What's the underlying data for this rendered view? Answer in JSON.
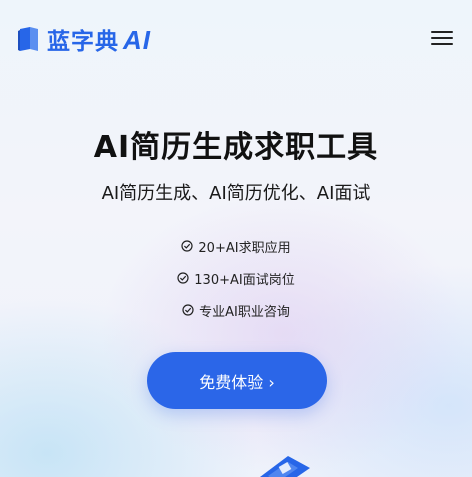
{
  "header": {
    "logo_text": "蓝字典",
    "logo_ai": "AI",
    "menu_icon": "hamburger-menu-icon"
  },
  "hero": {
    "title": "AI简历生成求职工具",
    "subtitle": "AI简历生成、AI简历优化、AI面试",
    "features": [
      {
        "icon": "check-circle-icon",
        "label": "20+AI求职应用"
      },
      {
        "icon": "check-circle-icon",
        "label": "130+AI面试岗位"
      },
      {
        "icon": "check-circle-icon",
        "label": "专业AI职业咨询"
      }
    ],
    "cta_label": "免费体验 ›"
  },
  "colors": {
    "brand": "#2766e8",
    "cta_bg": "#2b66e8",
    "text": "#111111"
  }
}
